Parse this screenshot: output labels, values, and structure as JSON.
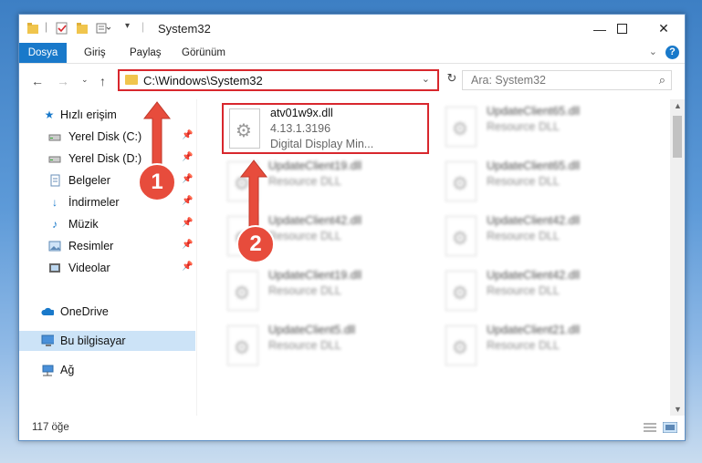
{
  "window": {
    "title": "System32",
    "minimize_icon": "minimize-icon",
    "maximize_icon": "maximize-icon",
    "close_icon": "close-icon"
  },
  "ribbon": {
    "tabs": [
      "Dosya",
      "Giriş",
      "Paylaş",
      "Görünüm"
    ],
    "accent": "#1979ca"
  },
  "address": {
    "path": "C:\\Windows\\System32",
    "search_placeholder": "Ara: System32"
  },
  "sidebar": {
    "items": [
      {
        "label": "Hızlı erişim",
        "icon": "star-icon",
        "pinned": false
      },
      {
        "label": "Yerel Disk (C:)",
        "icon": "drive-icon",
        "pinned": true
      },
      {
        "label": "Yerel Disk (D:)",
        "icon": "drive-icon",
        "pinned": true
      },
      {
        "label": "Belgeler",
        "icon": "documents-icon",
        "pinned": true
      },
      {
        "label": "İndirmeler",
        "icon": "download-icon",
        "pinned": true
      },
      {
        "label": "Müzik",
        "icon": "music-icon",
        "pinned": true
      },
      {
        "label": "Resimler",
        "icon": "pictures-icon",
        "pinned": true
      },
      {
        "label": "Videolar",
        "icon": "videos-icon",
        "pinned": true
      },
      {
        "label": "OneDrive",
        "icon": "cloud-icon",
        "pinned": false
      },
      {
        "label": "Bu bilgisayar",
        "icon": "computer-icon",
        "pinned": false,
        "selected": true
      },
      {
        "label": "Ağ",
        "icon": "network-icon",
        "pinned": false
      }
    ]
  },
  "files": [
    {
      "name": "atv01w9x.dll",
      "version": "4.13.1.3196",
      "description": "Digital Display Min...",
      "highlighted": true
    },
    {
      "name": "UpdateClient65.dll",
      "description": "Resource DLL"
    },
    {
      "name": "UpdateClient19.dll",
      "description": "Resource DLL"
    },
    {
      "name": "UpdateClient65.dll",
      "description": "Resource DLL"
    },
    {
      "name": "UpdateClient42.dll",
      "description": "Resource DLL"
    },
    {
      "name": "UpdateClient42.dll",
      "description": "Resource DLL"
    },
    {
      "name": "UpdateClient19.dll",
      "description": "Resource DLL"
    },
    {
      "name": "UpdateClient42.dll",
      "description": "Resource DLL"
    },
    {
      "name": "UpdateClient5.dll",
      "description": "Resource DLL"
    },
    {
      "name": "UpdateClient21.dll",
      "description": "Resource DLL"
    }
  ],
  "status": {
    "item_count": "117 öğe"
  },
  "annotations": {
    "step1": "1",
    "step2": "2",
    "color": "#d8272d"
  }
}
